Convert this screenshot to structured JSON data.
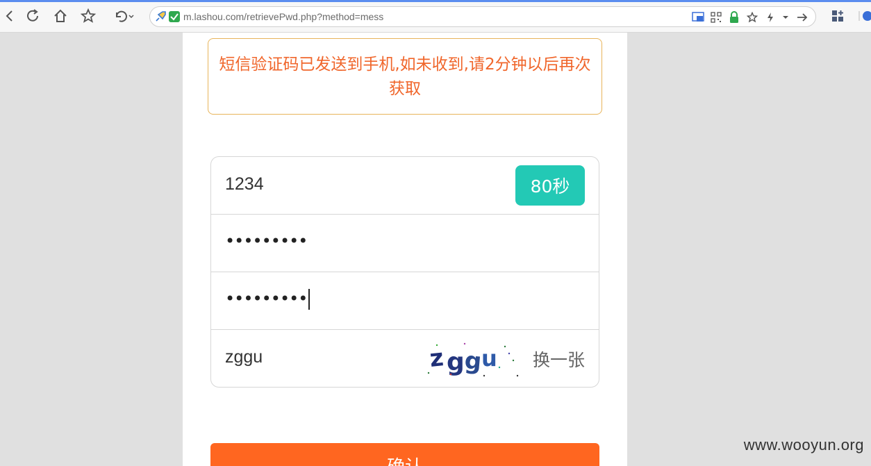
{
  "browser": {
    "url": "m.lashou.com/retrievePwd.php?method=mess"
  },
  "notice": {
    "text": "短信验证码已发送到手机,如未收到,请2分钟以后再次获取"
  },
  "form": {
    "sms_code_value": "1234",
    "timer_label": "80秒",
    "password_value": "•••••••••",
    "confirm_password_value": "•••••••••",
    "captcha_value": "zggu",
    "captcha_image_text": "zggu",
    "refresh_captcha_label": "换一张"
  },
  "submit": {
    "label": "确认"
  },
  "watermark": {
    "text": "www.wooyun.org"
  }
}
